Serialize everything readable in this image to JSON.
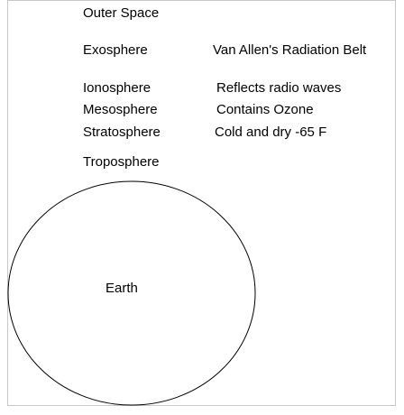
{
  "layers": {
    "outer_space": "Outer Space",
    "exosphere": "Exosphere",
    "ionosphere": "Ionosphere",
    "mesosphere": "Mesosphere",
    "stratosphere": "Stratosphere",
    "troposphere": "Troposphere"
  },
  "notes": {
    "exosphere": "Van Allen's Radiation Belt",
    "ionosphere": "Reflects radio waves",
    "mesosphere": "Contains Ozone",
    "stratosphere": "Cold and dry  -65 F"
  },
  "earth": {
    "label": "Earth"
  }
}
